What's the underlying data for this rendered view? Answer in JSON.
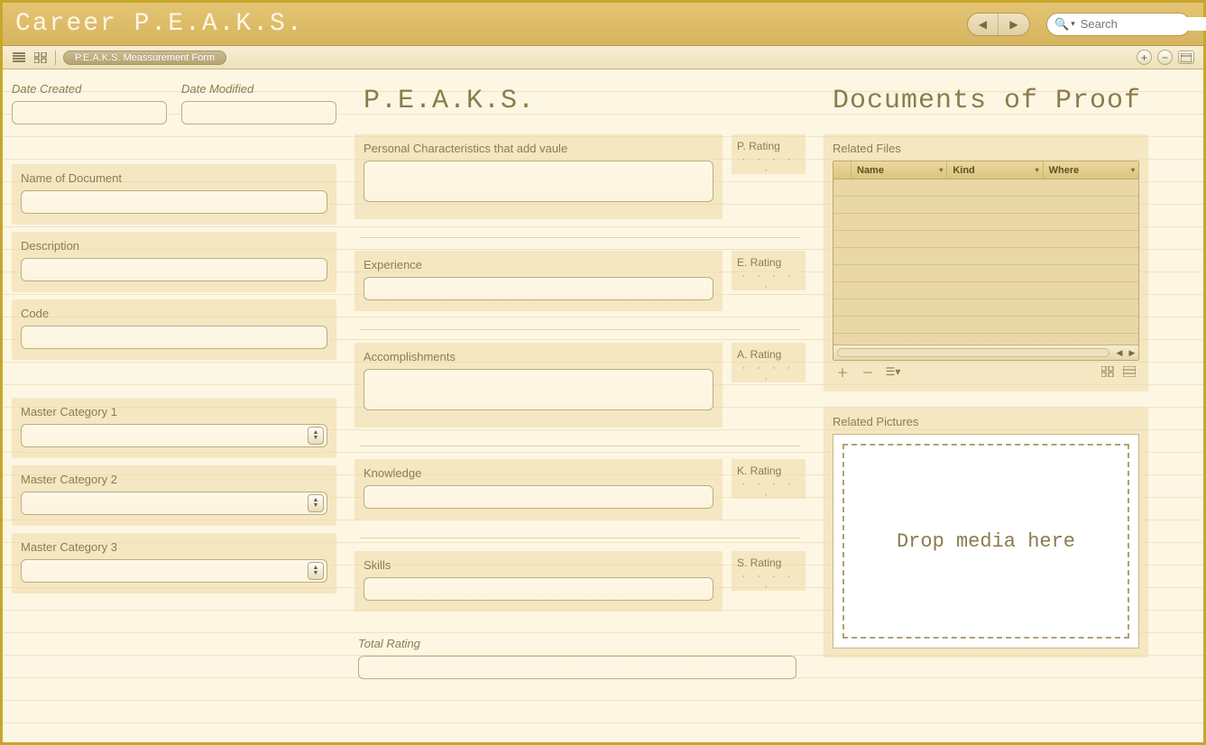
{
  "app": {
    "title": "Career P.E.A.K.S."
  },
  "nav": {
    "back": "◀",
    "forward": "▶"
  },
  "search": {
    "placeholder": "Search"
  },
  "toolbar": {
    "breadcrumb": "P.E.A.K.S. Meassurement Form",
    "add": "+",
    "remove": "−"
  },
  "left": {
    "date_created_label": "Date Created",
    "date_modified_label": "Date Modified",
    "name_label": "Name of Document",
    "description_label": "Description",
    "code_label": "Code",
    "mc1_label": "Master Category 1",
    "mc2_label": "Master Category 2",
    "mc3_label": "Master Category 3"
  },
  "peaks": {
    "heading": "P.E.A.K.S.",
    "p_label": "Personal Characteristics that add vaule",
    "p_rating": "P. Rating",
    "e_label": "Experience",
    "e_rating": "E. Rating",
    "a_label": "Accomplishments",
    "a_rating": "A. Rating",
    "k_label": "Knowledge",
    "k_rating": "K. Rating",
    "s_label": "Skills",
    "s_rating": "S. Rating",
    "total_label": "Total Rating",
    "dots": "· · · · ·"
  },
  "right": {
    "heading": "Documents of Proof",
    "files_label": "Related Files",
    "col_name": "Name",
    "col_kind": "Kind",
    "col_where": "Where",
    "pictures_label": "Related Pictures",
    "drop_text": "Drop media here"
  }
}
